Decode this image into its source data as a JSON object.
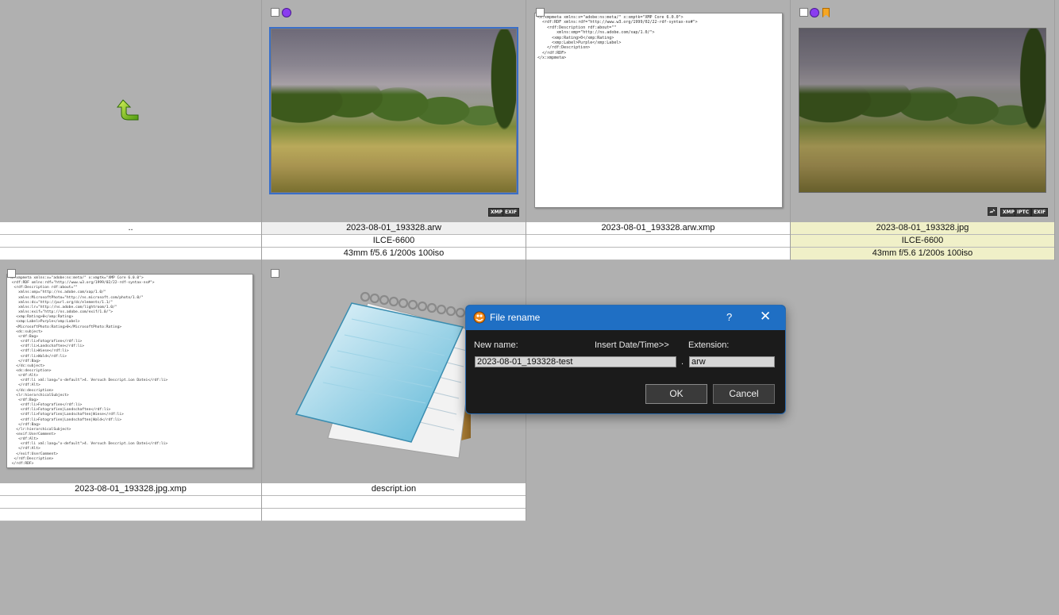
{
  "grid": {
    "row1": [
      {
        "name": "..",
        "camera": "",
        "exposure": ""
      },
      {
        "name": "2023-08-01_193328.arw",
        "camera": "ILCE-6600",
        "exposure": "43mm f/5.6 1/200s 100iso"
      },
      {
        "name": "2023-08-01_193328.arw.xmp",
        "camera": "",
        "exposure": ""
      },
      {
        "name": "2023-08-01_193328.jpg",
        "camera": "ILCE-6600",
        "exposure": "43mm f/5.6 1/200s 100iso"
      }
    ],
    "row2": [
      {
        "name": "2023-08-01_193328.jpg.xmp",
        "camera": "",
        "exposure": ""
      },
      {
        "name": "descript.ion",
        "camera": "",
        "exposure": ""
      }
    ],
    "badges_arw": [
      "XMP",
      "EXIF"
    ],
    "badges_jpg": [
      "XMP",
      "IPTC",
      "EXIF"
    ],
    "xmp_small": "<x:xmpmeta xmlns:x=\"adobe:ns:meta/\" x:xmptk=\"XMP Core 6.0.0\">\n  <rdf:RDF xmlns:rdf=\"http://www.w3.org/1999/02/22-rdf-syntax-ns#\">\n    <rdf:Description rdf:about=\"\"\n        xmlns:xmp=\"http://ns.adobe.com/xap/1.0/\">\n      <xmp:Rating>0</xmp:Rating>\n      <xmp:Label>Purple</xmp:Label>\n    </rdf:Description>\n  </rdf:RDF>\n</x:xmpmeta>",
    "xmp_large": "<x:xmpmeta xmlns:x=\"adobe:ns:meta/\" x:xmptk=\"XMP Core 6.0.0\">\n <rdf:RDF xmlns:rdf=\"http://www.w3.org/1999/02/22-rdf-syntax-ns#\">\n  <rdf:Description rdf:about=\"\"\n    xmlns:xmp=\"http://ns.adobe.com/xap/1.0/\"\n    xmlns:MicrosoftPhoto=\"http://ns.microsoft.com/photo/1.0/\"\n    xmlns:dc=\"http://purl.org/dc/elements/1.1/\"\n    xmlns:lr=\"http://ns.adobe.com/lightroom/1.0/\"\n    xmlns:exif=\"http://ns.adobe.com/exif/1.0/\">\n   <xmp:Rating>0</xmp:Rating>\n   <xmp:Label>Purple</xmp:Label>\n   <MicrosoftPhoto:Rating>0</MicrosoftPhoto:Rating>\n   <dc:subject>\n    <rdf:Bag>\n     <rdf:li>Fotografien</rdf:li>\n     <rdf:li>Landschaften</rdf:li>\n     <rdf:li>Wiese</rdf:li>\n     <rdf:li>Wald</rdf:li>\n    </rdf:Bag>\n   </dc:subject>\n   <dc:description>\n    <rdf:Alt>\n     <rdf:li xml:lang=\"x-default\">4. Versuch Descript.ion Datei</rdf:li>\n    </rdf:Alt>\n   </dc:description>\n   <lr:hierarchicalSubject>\n    <rdf:Bag>\n     <rdf:li>Fotografien</rdf:li>\n     <rdf:li>Fotografien|Landschaften</rdf:li>\n     <rdf:li>Fotografien|Landschaften|Wiese</rdf:li>\n     <rdf:li>Fotografien|Landschaften|Wald</rdf:li>\n    </rdf:Bag>\n   </lr:hierarchicalSubject>\n   <exif:UserComment>\n    <rdf:Alt>\n     <rdf:li xml:lang=\"x-default\">4. Versuch Descript.ion Datei</rdf:li>\n    </rdf:Alt>\n   </exif:UserComment>\n  </rdf:Description>\n </rdf:RDF>"
  },
  "dialog": {
    "title": "File rename",
    "help": "?",
    "close": "✕",
    "new_name_label": "New name:",
    "insert_label": "Insert Date/Time>>",
    "extension_label": "Extension:",
    "dot": ".",
    "new_name_value": "2023-08-01_193328-test",
    "extension_value": "arw",
    "ok_label": "OK",
    "cancel_label": "Cancel"
  },
  "colors": {
    "background": "#b0b0b0",
    "selection": "#3a6fc8",
    "dialog_title": "#1f6fc4",
    "purple_label": "#8a3cf0",
    "bookmark": "#f5a623"
  }
}
